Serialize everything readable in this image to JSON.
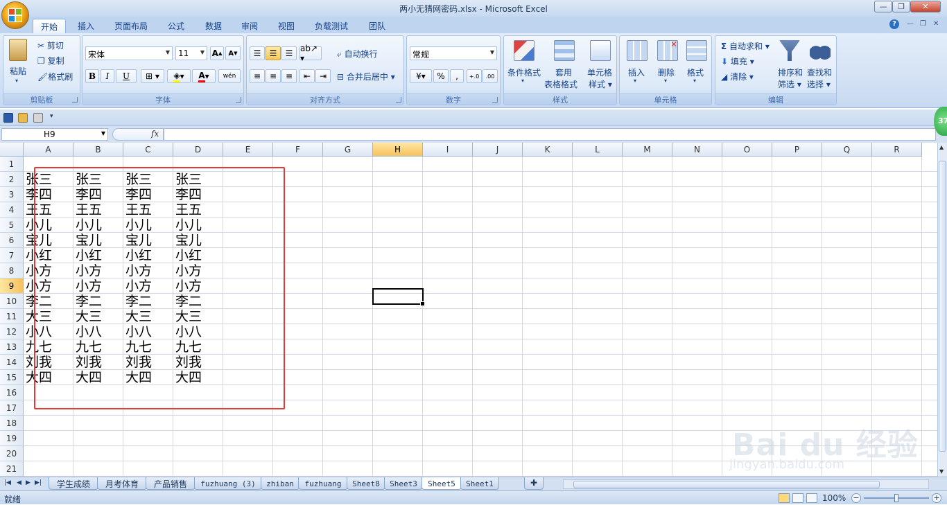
{
  "app": {
    "title": "两小无猜网密码.xlsx - Microsoft Excel"
  },
  "window_controls": {
    "minimize": "—",
    "maximize": "❐",
    "close": "✕"
  },
  "ribbon_tabs": [
    "开始",
    "插入",
    "页面布局",
    "公式",
    "数据",
    "审阅",
    "视图",
    "负载测试",
    "团队"
  ],
  "ribbon": {
    "clipboard": {
      "label": "剪贴板",
      "paste": "粘贴",
      "cut": "剪切",
      "copy": "复制",
      "format_painter": "格式刷"
    },
    "font": {
      "label": "字体",
      "font_name": "宋体",
      "font_size": "11",
      "bold": "B",
      "italic": "I",
      "underline": "U",
      "font_color": "A",
      "wen": "wén"
    },
    "alignment": {
      "label": "对齐方式",
      "wrap_text": "自动换行",
      "merge_center": "合并后居中"
    },
    "number": {
      "label": "数字",
      "format": "常规",
      "percent": "%",
      "comma": ",",
      "dec_inc": "+.0",
      "dec_dec": ".00"
    },
    "styles": {
      "label": "样式",
      "conditional": "条件格式",
      "table_line1": "套用",
      "table_line2": "表格格式",
      "cell_line1": "单元格",
      "cell_line2": "样式"
    },
    "cells": {
      "label": "单元格",
      "insert": "插入",
      "delete": "删除",
      "format": "格式"
    },
    "editing": {
      "label": "编辑",
      "autosum": "自动求和",
      "fill": "填充",
      "clear": "清除",
      "sort_line1": "排序和",
      "sort_line2": "筛选",
      "find_line1": "查找和",
      "find_line2": "选择",
      "sigma": "Σ"
    }
  },
  "help": "?",
  "badge": "37",
  "formula_bar": {
    "name_box": "H9",
    "fx": "fx",
    "formula": ""
  },
  "columns": [
    "A",
    "B",
    "C",
    "D",
    "E",
    "F",
    "G",
    "H",
    "I",
    "J",
    "K",
    "L",
    "M",
    "N",
    "O",
    "P",
    "Q",
    "R"
  ],
  "selected_column": "H",
  "rows": [
    "1",
    "2",
    "3",
    "4",
    "5",
    "6",
    "7",
    "8",
    "9",
    "10",
    "11",
    "12",
    "13",
    "14",
    "15",
    "16",
    "17",
    "18",
    "19",
    "20",
    "21",
    "22"
  ],
  "selected_row": "9",
  "cell_data": [
    [],
    [
      "张三",
      "张三",
      "张三",
      "张三"
    ],
    [
      "李四",
      "李四",
      "李四",
      "李四"
    ],
    [
      "王五",
      "王五",
      "王五",
      "王五"
    ],
    [
      "小儿",
      "小儿",
      "小儿",
      "小儿"
    ],
    [
      "宝儿",
      "宝儿",
      "宝儿",
      "宝儿"
    ],
    [
      "小红",
      "小红",
      "小红",
      "小红"
    ],
    [
      "小方",
      "小方",
      "小方",
      "小方"
    ],
    [
      "小方",
      "小方",
      "小方",
      "小方"
    ],
    [
      "李二",
      "李二",
      "李二",
      "李二"
    ],
    [
      "大三",
      "大三",
      "大三",
      "大三"
    ],
    [
      "小八",
      "小八",
      "小八",
      "小八"
    ],
    [
      "九七",
      "九七",
      "九七",
      "九七"
    ],
    [
      "刘我",
      "刘我",
      "刘我",
      "刘我"
    ],
    [
      "大四",
      "大四",
      "大四",
      "大四"
    ]
  ],
  "sheet_tabs": [
    {
      "name": "学生成绩",
      "active": false,
      "mono": false
    },
    {
      "name": "月考体育",
      "active": false,
      "mono": false
    },
    {
      "name": "产品销售",
      "active": false,
      "mono": false
    },
    {
      "name": "fuzhuang (3)",
      "active": false,
      "mono": true
    },
    {
      "name": "zhiban",
      "active": false,
      "mono": true
    },
    {
      "name": "fuzhuang",
      "active": false,
      "mono": true
    },
    {
      "name": "Sheet8",
      "active": false,
      "mono": true
    },
    {
      "name": "Sheet3",
      "active": false,
      "mono": true
    },
    {
      "name": "Sheet5",
      "active": true,
      "mono": true
    },
    {
      "name": "Sheet1",
      "active": false,
      "mono": true
    }
  ],
  "status": {
    "text": "就绪",
    "zoom": "100%"
  },
  "watermark": {
    "text": "Bai du 经验",
    "sub": "jingyan.baidu.com"
  }
}
